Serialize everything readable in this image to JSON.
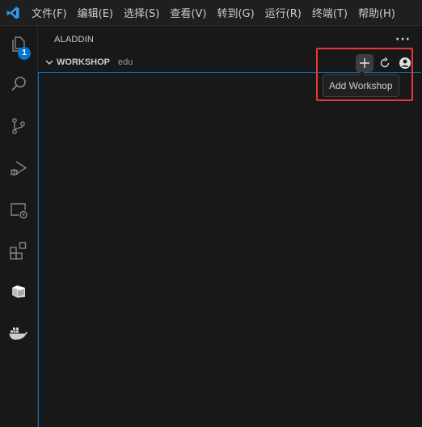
{
  "menubar": {
    "items": [
      "文件(F)",
      "编辑(E)",
      "选择(S)",
      "查看(V)",
      "转到(G)",
      "运行(R)",
      "终端(T)",
      "帮助(H)"
    ]
  },
  "activitybar": {
    "explorer_badge": "1",
    "icons": [
      "explorer-icon",
      "search-icon",
      "source-control-icon",
      "run-debug-icon",
      "remote-explorer-icon",
      "extensions-icon",
      "aladdin-icon",
      "docker-icon"
    ]
  },
  "sidebar": {
    "title": "ALADDIN",
    "more_actions": "···",
    "section": {
      "title": "WORKSHOP",
      "description": "edu",
      "actions": [
        "add-icon",
        "refresh-icon",
        "account-icon"
      ]
    }
  },
  "tooltip": {
    "text": "Add Workshop"
  },
  "colors": {
    "accent": "#0078d4",
    "highlight": "#e53935",
    "background": "#181818"
  }
}
